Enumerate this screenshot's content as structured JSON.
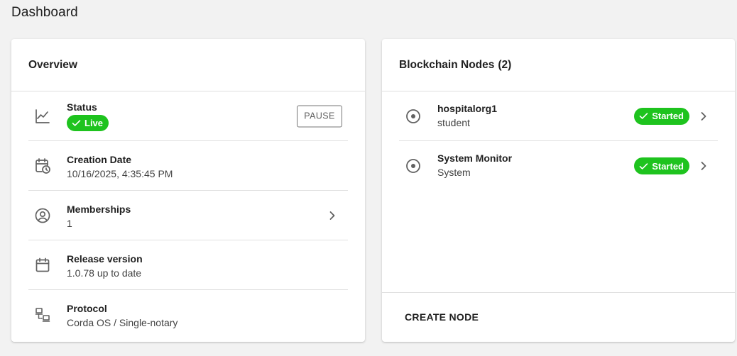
{
  "page": {
    "title": "Dashboard"
  },
  "overview": {
    "title": "Overview",
    "status": {
      "label": "Status",
      "chip": "Live",
      "chip_color": "#1ec31e",
      "pause_label": "PAUSE"
    },
    "creation_date": {
      "label": "Creation Date",
      "value": "10/16/2025, 4:35:45 PM"
    },
    "memberships": {
      "label": "Memberships",
      "value": "1"
    },
    "release_version": {
      "label": "Release version",
      "value": "1.0.78 up to date"
    },
    "protocol": {
      "label": "Protocol",
      "value": "Corda OS / Single-notary"
    }
  },
  "nodes": {
    "title": "Blockchain Nodes",
    "count": "(2)",
    "items": [
      {
        "name": "hospitalorg1",
        "sub": "student",
        "status": "Started"
      },
      {
        "name": "System Monitor",
        "sub": "System",
        "status": "Started"
      }
    ],
    "create_label": "CREATE NODE"
  },
  "icons": {
    "status": "line-chart-icon",
    "creation_date": "calendar-clock-icon",
    "memberships": "account-circle-icon",
    "release_version": "calendar-icon",
    "protocol": "network-icon",
    "node": "radio-button-checked-icon",
    "chevron": "chevron-right-icon",
    "check": "check-icon"
  },
  "colors": {
    "accent_green": "#1ec31e",
    "background": "#f2f2f2"
  }
}
